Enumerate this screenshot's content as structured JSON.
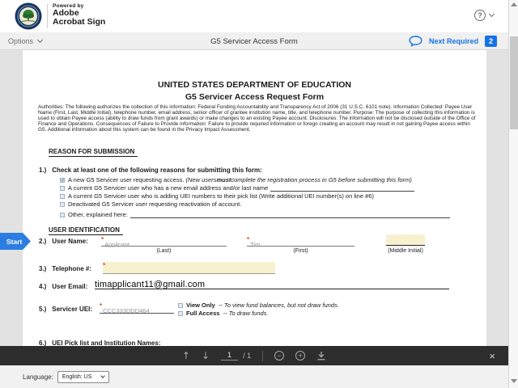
{
  "header": {
    "powered_by": "Powered by",
    "brand_line1": "Adobe",
    "brand_line2": "Acrobat Sign",
    "help_glyph": "?"
  },
  "toolbar": {
    "options_label": "Options",
    "document_title": "G5 Servicer Access Form",
    "next_required_label": "Next Required",
    "next_required_count": "2"
  },
  "start_tab": {
    "label": "Start"
  },
  "colors": {
    "accent_blue": "#1473e6",
    "field_highlight_yellow": "#f8f1cf",
    "required_marker_red": "#e0492a"
  },
  "form": {
    "title1": "UNITED STATES DEPARTMENT OF EDUCATION",
    "title2": "G5 Servicer Access Request Form",
    "authorities_text": "Authorities: The following authorizes the collection of this information: Federal Funding Accountability and Transparency Act of 2006 (31 U.S.C. 6101 note). Information Collected: Payee User Name (First, Last, Middle Initial), telephone number, email address, senior officer of grantee institution name, title, and telephone number. Purpose: The purpose of collecting this information is used to obtain Payee access (ability to draw funds from grant awards) or make changes to an existing Payee account. Disclosures: The information will not be disclosed outside of the Office of Finance and Operations. Consequences of Failure to Provide information: Failure to provide required information or forego creating an account may result in not gaining Payee access within G5. Additional information about this system can be found in the Privacy Impact Assessment.",
    "required_marker": "*",
    "section1": {
      "heading": "REASON FOR SUBMISSION",
      "q1_num": "1.)",
      "q1_text": "Check at least one of the following reasons for submitting this form:",
      "reasons": [
        {
          "checked": true,
          "text": "A new G5 Servicer user requesting access.",
          "italic_pre": "(New users ",
          "italic_bold": "must",
          "italic_post": " complete the registration process in G5 before submitting this form)"
        },
        {
          "checked": false,
          "text": "A current G5 Servicer user who has a new email address and/or last name"
        },
        {
          "checked": false,
          "text": "A current G5 Servicer user who is adding UEI numbers to their pick list (Write additional UEI number(s) on line #6)"
        },
        {
          "checked": false,
          "text": "Deactivated G5 Servicer user requesting reactivation of account."
        },
        {
          "checked": false,
          "text": "Other, explained here:"
        }
      ]
    },
    "section2": {
      "heading": "USER IDENTIFICATION",
      "row2": {
        "num": "2.)",
        "label": "User Name:",
        "last_value": "Applicant",
        "last_caption": "(Last)",
        "first_value": "Tim",
        "first_caption": "(First)",
        "middle_value": "",
        "middle_caption": "(Middle Initial)"
      },
      "row3": {
        "num": "3.)",
        "label": "Telephone #:",
        "value": ""
      },
      "row4": {
        "num": "4.)",
        "label": "User Email:",
        "value": "timapplicant11@gmail.com"
      },
      "row5": {
        "num": "5.)",
        "label": "Servicer UEI:",
        "value": "CCC333DDD464",
        "view_only_label": "View Only",
        "view_only_desc": "-- To view fund balances, but not draw funds.",
        "full_access_label": "Full Access",
        "full_access_desc": "-- To draw funds."
      },
      "row6": {
        "num": "6.)",
        "label": "UEI Pick list and Institution Names:"
      }
    }
  },
  "pdf_toolbar": {
    "page_current": "1",
    "page_total": "/ 1"
  },
  "language_bar": {
    "label": "Language:",
    "selected": "English: US"
  }
}
